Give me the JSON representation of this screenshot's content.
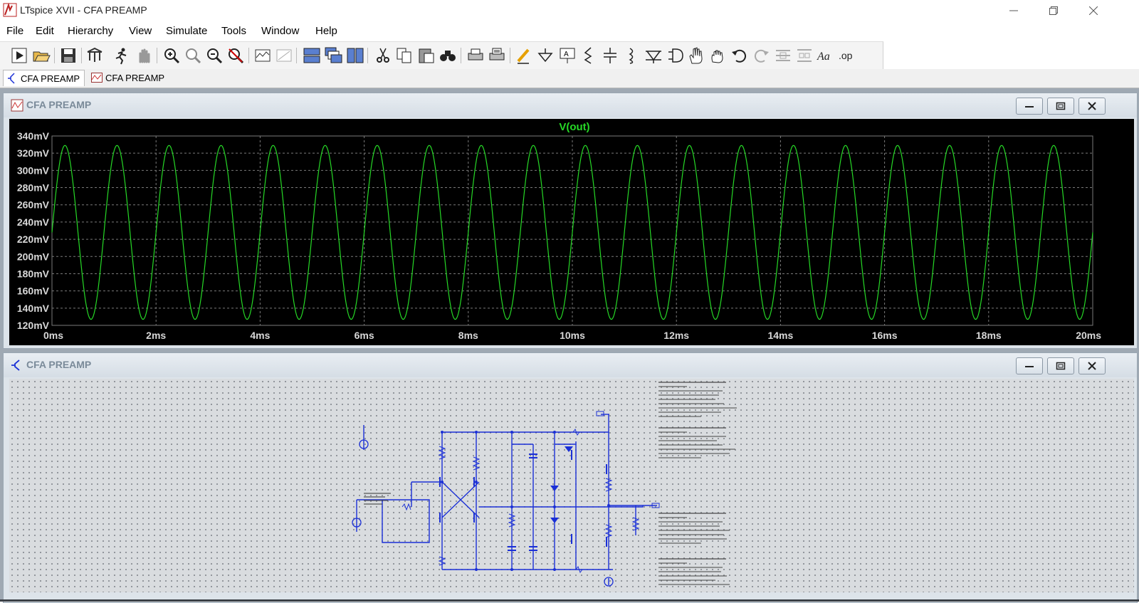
{
  "window": {
    "title": "LTspice XVII - CFA PREAMP"
  },
  "menu": [
    "File",
    "Edit",
    "Hierarchy",
    "View",
    "Simulate",
    "Tools",
    "Window",
    "Help"
  ],
  "toolbar": {
    "icons": [
      "run-icon",
      "open-icon",
      "save-icon",
      "control-panel-icon",
      "run-man-icon",
      "halt-icon",
      "zoom-in-icon",
      "zoom-area-icon",
      "zoom-out-icon",
      "zoom-cancel-icon",
      "autoscale-icon",
      "delete-trace-icon",
      "tile-horizontal-icon",
      "cascade-icon",
      "tile-vertical-icon",
      "cut-icon",
      "copy-icon",
      "paste-icon",
      "find-icon",
      "print-icon",
      "print-preview-icon",
      "wire-icon",
      "ground-icon",
      "label-icon",
      "resistor-icon",
      "capacitor-icon",
      "inductor-icon",
      "diode-icon",
      "component-icon",
      "move-icon",
      "drag-icon",
      "undo-icon",
      "redo-icon",
      "rotate-icon",
      "mirror-icon",
      "text-icon",
      "spice-directive-icon"
    ],
    "spice_directive_label": ".op",
    "text_label": "Aa"
  },
  "tabs": [
    {
      "label": "CFA PREAMP",
      "kind": "schematic",
      "active": true
    },
    {
      "label": "CFA PREAMP",
      "kind": "waveform",
      "active": false
    }
  ],
  "waveform_window": {
    "title": "CFA PREAMP"
  },
  "schematic_window": {
    "title": "CFA PREAMP"
  },
  "colors": {
    "trace": "#26d926",
    "grid": "#7a7a7a",
    "wire": "#1a2fd6",
    "plot_bg": "#000000"
  },
  "chart_data": {
    "type": "line",
    "title": "V(out)",
    "xlabel": "",
    "ylabel": "",
    "x_unit": "ms",
    "y_unit": "mV",
    "xlim": [
      0,
      20
    ],
    "ylim": [
      120,
      340
    ],
    "x_ticks": [
      "0ms",
      "2ms",
      "4ms",
      "6ms",
      "8ms",
      "10ms",
      "12ms",
      "14ms",
      "16ms",
      "18ms",
      "20ms"
    ],
    "y_ticks": [
      "340mV",
      "320mV",
      "300mV",
      "280mV",
      "260mV",
      "240mV",
      "220mV",
      "200mV",
      "180mV",
      "160mV",
      "140mV",
      "120mV"
    ],
    "grid": true,
    "series": [
      {
        "name": "V(out)",
        "waveform": "sine",
        "frequency_hz": 1000,
        "min_mV": 127,
        "max_mV": 329,
        "start_mV": 228,
        "color": "#26d926"
      }
    ]
  }
}
